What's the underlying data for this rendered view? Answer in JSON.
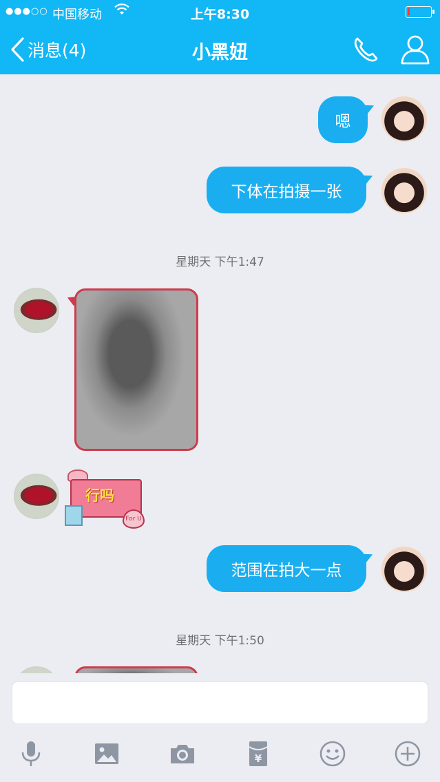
{
  "status_bar": {
    "signal": "●●●○○",
    "carrier": "中国移动",
    "time": "上午8:30"
  },
  "nav": {
    "back_label": "消息(4)",
    "title": "小黑妞"
  },
  "messages": {
    "m1": "嗯",
    "m2": "下体在拍摄一张",
    "ts1": "星期天 下午1:47",
    "sticker_text": "行吗",
    "sticker_heart": "For U",
    "m3": "范围在拍大一点",
    "ts2": "星期天 下午1:50"
  },
  "input": {
    "placeholder": ""
  },
  "toolbar": [
    "mic-icon",
    "image-icon",
    "camera-icon",
    "red-packet-icon",
    "emoji-icon",
    "plus-icon"
  ],
  "colors": {
    "nav_bg": "#12b7f5",
    "bubble_bg": "#1aaef0",
    "chat_bg": "#ebedf2",
    "icon_gray": "#8e96a3"
  }
}
